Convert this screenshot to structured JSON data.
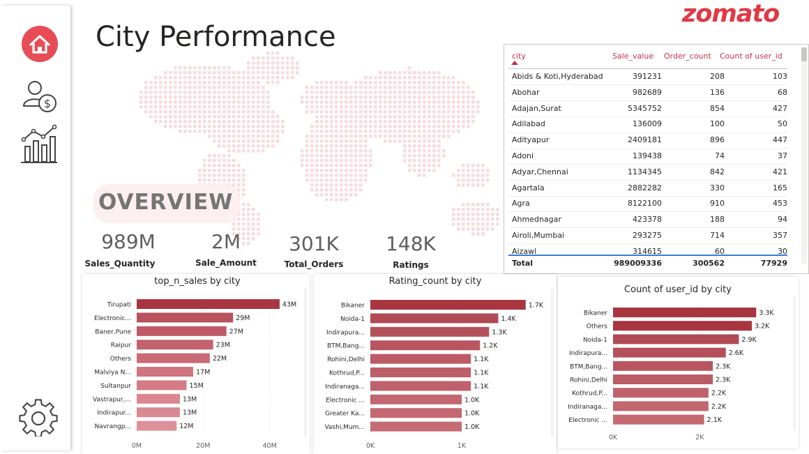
{
  "brand": {
    "logo_text": "zomato",
    "accent": "#e23744"
  },
  "sidebar": {
    "items": [
      {
        "icon": "home-icon"
      },
      {
        "icon": "user-sales-icon"
      },
      {
        "icon": "bar-chart-icon"
      },
      {
        "icon": "gear-icon"
      }
    ]
  },
  "page": {
    "title": "City Performance"
  },
  "overview": {
    "label": "OVERVIEW"
  },
  "kpis": [
    {
      "value": "989M",
      "label": "Sales_Quantity"
    },
    {
      "value": "2M",
      "label": "Sale_Amount"
    },
    {
      "value": "301K",
      "label": "Total_Orders"
    },
    {
      "value": "148K",
      "label": "Ratings"
    }
  ],
  "table": {
    "columns": [
      "city",
      "Sale_value",
      "Order_count",
      "Count of user_id"
    ],
    "rows": [
      [
        "Abids & Koti,Hyderabad",
        "391231",
        "208",
        "103"
      ],
      [
        "Abohar",
        "982689",
        "136",
        "68"
      ],
      [
        "Adajan,Surat",
        "5345752",
        "854",
        "427"
      ],
      [
        "Adilabad",
        "136009",
        "100",
        "50"
      ],
      [
        "Adityapur",
        "2409181",
        "896",
        "447"
      ],
      [
        "Adoni",
        "139438",
        "74",
        "37"
      ],
      [
        "Adyar,Chennai",
        "1134345",
        "842",
        "421"
      ],
      [
        "Agartala",
        "2882282",
        "330",
        "165"
      ],
      [
        "Agra",
        "8122100",
        "910",
        "453"
      ],
      [
        "Ahmednagar",
        "423378",
        "188",
        "94"
      ],
      [
        "Airoli,Mumbai",
        "293275",
        "714",
        "357"
      ],
      [
        "Aizawl",
        "314615",
        "60",
        "30"
      ]
    ],
    "total": [
      "Total",
      "989009336",
      "300562",
      "77929"
    ]
  },
  "chart_data": [
    {
      "type": "bar",
      "orientation": "horizontal",
      "title": "top_n_sales by city",
      "categories": [
        "Tirupati",
        "Electronic...",
        "Baner,Pune",
        "Raipur",
        "Others",
        "Malviya N...",
        "Sultanpur",
        "Vastrapur,...",
        "Indirapur...",
        "Navrangp..."
      ],
      "values": [
        43,
        29,
        27,
        23,
        22,
        17,
        15,
        13,
        13,
        12
      ],
      "value_labels": [
        "43M",
        "29M",
        "27M",
        "23M",
        "22M",
        "17M",
        "15M",
        "13M",
        "13M",
        "12M"
      ],
      "ticks": [
        "0M",
        "20M",
        "40M"
      ],
      "tick_values": [
        0,
        20,
        40
      ],
      "xlim": [
        0,
        47
      ],
      "gridlines": "vertical-dotted",
      "colors": [
        "#a93541",
        "#b8525d",
        "#bf5a66",
        "#c4636d",
        "#c96a75",
        "#d0747f",
        "#d47c86",
        "#d9868f",
        "#da8891",
        "#de9099"
      ]
    },
    {
      "type": "bar",
      "orientation": "horizontal",
      "title": "Rating_count by city",
      "categories": [
        "Bikaner",
        "Noida-1",
        "Indirapura...",
        "BTM,Bang...",
        "Rohini,Delhi",
        "Kothrud,P...",
        "Indiranaga...",
        "Electronic ...",
        "Greater Ka...",
        "Vashi,Mum..."
      ],
      "values": [
        1.7,
        1.4,
        1.3,
        1.2,
        1.1,
        1.1,
        1.1,
        1.0,
        1.0,
        1.0
      ],
      "value_labels": [
        "1.7K",
        "1.4K",
        "1.3K",
        "1.2K",
        "1.1K",
        "1.1K",
        "1.1K",
        "1.0K",
        "1.0K",
        "1.0K"
      ],
      "ticks": [
        "0K",
        "1K"
      ],
      "tick_values": [
        0,
        1
      ],
      "xlim": [
        0,
        1.74
      ],
      "gridlines": "vertical-dotted",
      "colors": [
        "#a93541",
        "#b04a55",
        "#b4505b",
        "#b85660",
        "#bb5b65",
        "#bd5e68",
        "#bf616b",
        "#c2666f",
        "#c46972",
        "#c56b74"
      ]
    },
    {
      "type": "bar",
      "orientation": "horizontal",
      "title": "Count of user_id by city",
      "categories": [
        "Bikaner",
        "Others",
        "Noida-1",
        "Indirapura...",
        "BTM,Bang...",
        "Rohini,Delhi",
        "Kothrud,P...",
        "Indiranaga...",
        "Electronic ..."
      ],
      "values": [
        3.3,
        3.2,
        2.9,
        2.6,
        2.3,
        2.3,
        2.2,
        2.2,
        2.1
      ],
      "value_labels": [
        "3.3K",
        "3.2K",
        "2.9K",
        "2.6K",
        "2.3K",
        "2.3K",
        "2.2K",
        "2.2K",
        "2.1K"
      ],
      "ticks": [
        "0K",
        "2K"
      ],
      "tick_values": [
        0,
        2
      ],
      "xlim": [
        0,
        3.44
      ],
      "gridlines": "vertical-dotted",
      "colors": [
        "#a93541",
        "#a93541",
        "#b04a55",
        "#b4505b",
        "#b85660",
        "#bb5b65",
        "#bf616b",
        "#c2666f",
        "#c46972"
      ]
    }
  ]
}
